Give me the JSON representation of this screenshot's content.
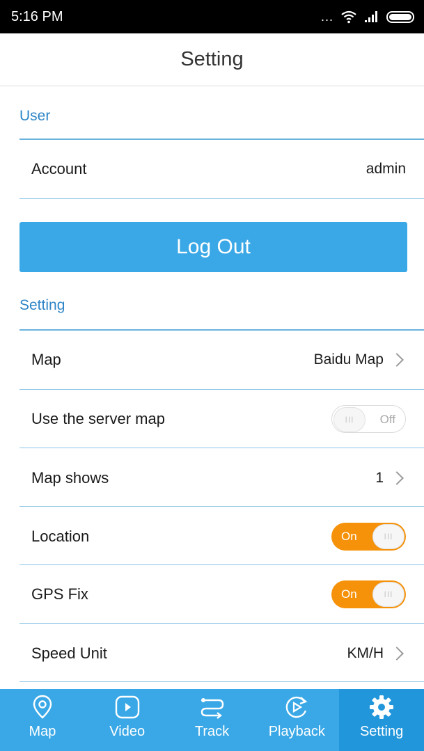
{
  "status_bar": {
    "time": "5:16 PM",
    "dots": "..."
  },
  "header": {
    "title": "Setting"
  },
  "user_section": {
    "title": "User",
    "account_label": "Account",
    "account_value": "admin"
  },
  "logout_label": "Log Out",
  "setting_section": {
    "title": "Setting",
    "map": {
      "label": "Map",
      "value": "Baidu Map"
    },
    "server_map": {
      "label": "Use the server map",
      "toggle_text": "Off",
      "state": "off"
    },
    "map_shows": {
      "label": "Map shows",
      "value": "1"
    },
    "location": {
      "label": "Location",
      "toggle_text": "On",
      "state": "on"
    },
    "gps_fix": {
      "label": "GPS Fix",
      "toggle_text": "On",
      "state": "on"
    },
    "speed_unit": {
      "label": "Speed Unit",
      "value": "KM/H"
    }
  },
  "tabs": [
    {
      "label": "Map",
      "icon": "map-pin-icon"
    },
    {
      "label": "Video",
      "icon": "play-icon"
    },
    {
      "label": "Track",
      "icon": "track-icon"
    },
    {
      "label": "Playback",
      "icon": "playback-icon"
    },
    {
      "label": "Setting",
      "icon": "gear-icon",
      "active": true
    }
  ],
  "colors": {
    "accent": "#3aa8e6",
    "section_title": "#2e86c8",
    "toggle_on": "#f5920a"
  }
}
